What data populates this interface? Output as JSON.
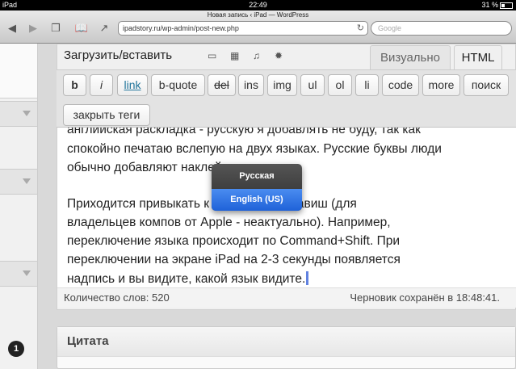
{
  "status_bar": {
    "device": "iPad",
    "time": "22:49",
    "battery": "31 %"
  },
  "browser": {
    "page_title": "Новая запись ‹ iPad — WordPress",
    "url": "ipadstory.ru/wp-admin/post-new.php",
    "search_placeholder": "Google"
  },
  "editor": {
    "upload_label": "Загрузить/вставить",
    "tabs": {
      "visual": "Визуально",
      "html": "HTML"
    },
    "buttons": {
      "b": "b",
      "i": "i",
      "link": "link",
      "bquote": "b-quote",
      "del": "del",
      "ins": "ins",
      "img": "img",
      "ul": "ul",
      "ol": "ol",
      "li": "li",
      "code": "code",
      "more": "more",
      "search": "поиск",
      "close_tags": "закрыть теги"
    },
    "content_lines": [
      "английская раскладка - русскую я добавлять не буду, так как",
      "спокойно печатаю вслепую на двух языках. Русские буквы люди",
      "обычно добавляют наклейками.",
      "Приходится привыкать к сочетаниям клавиш (для",
      "владельцев компов от Apple - неактуально). Например,",
      "переключение языка происходит по Command+Shift. При",
      "переключении на экране iPad на 2-3 секунды появляется",
      "надпись и вы видите, какой язык видите."
    ],
    "word_count": "Количество слов: 520",
    "draft_saved": "Черновик сохранён в 18:48:41."
  },
  "language_popup": {
    "option1": "Русская",
    "option2": "English (US)"
  },
  "quote_box": {
    "title": "Цитата"
  },
  "sidebar": {
    "badge": "1"
  }
}
